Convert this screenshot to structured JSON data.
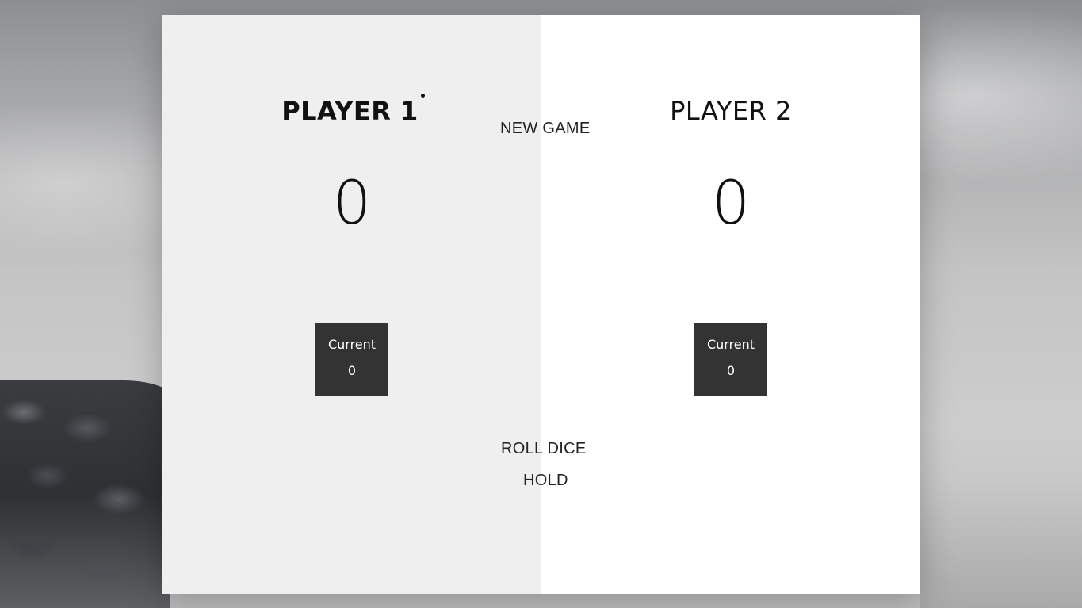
{
  "players": [
    {
      "name": "PLAYER 1",
      "score": "0",
      "current_label": "Current",
      "current_score": "0",
      "active": true
    },
    {
      "name": "PLAYER 2",
      "score": "0",
      "current_label": "Current",
      "current_score": "0",
      "active": false
    }
  ],
  "buttons": {
    "new_game": "NEW GAME",
    "roll_dice": "ROLL DICE",
    "hold": "HOLD"
  },
  "colors": {
    "active_panel": "#efefef",
    "inactive_panel": "#ffffff",
    "current_box": "#333333"
  }
}
